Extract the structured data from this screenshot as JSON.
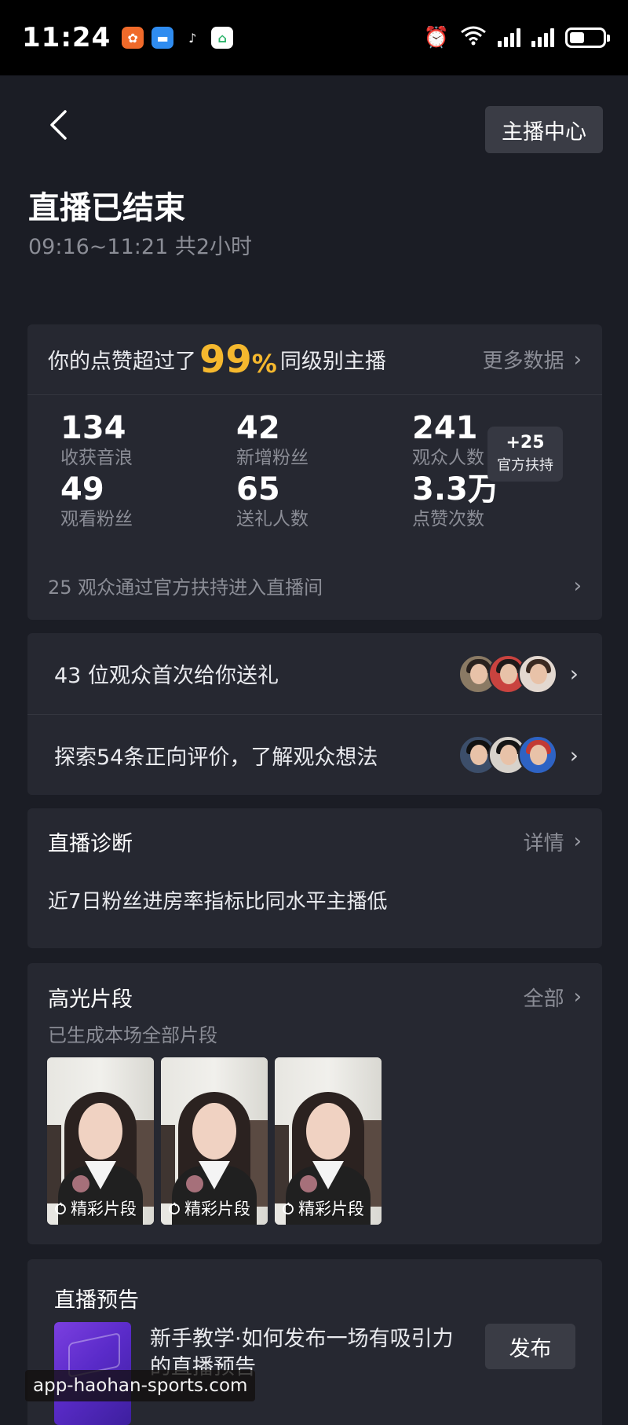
{
  "status_bar": {
    "time": "11:24",
    "apps": [
      {
        "name": "orange-app-icon",
        "color": "#f06a2a"
      },
      {
        "name": "chat-app-icon",
        "color": "#2f8cf0"
      },
      {
        "name": "tiktok-app-icon",
        "color": "#000000"
      },
      {
        "name": "home-app-icon",
        "color": "#ffffff"
      }
    ],
    "battery_level": 0.45
  },
  "header": {
    "back_label": "back",
    "anchor_center_label": "主播中心",
    "title": "直播已结束",
    "subtitle": "09:16~11:21 共2小时"
  },
  "summary": {
    "prefix": "你的点赞超过了",
    "percent": "99",
    "percent_unit": "%",
    "suffix": "同级别主播",
    "more_link": "更多数据",
    "stats": [
      {
        "value": "134",
        "label": "收获音浪"
      },
      {
        "value": "42",
        "label": "新增粉丝"
      },
      {
        "value": "241",
        "label": "观众人数"
      },
      {
        "value": "49",
        "label": "观看粉丝"
      },
      {
        "value": "65",
        "label": "送礼人数"
      },
      {
        "value": "3.3万",
        "label": "点赞次数"
      }
    ],
    "support_badge": {
      "plus": "+25",
      "label": "官方扶持"
    },
    "footer": "25 观众通过官方扶持进入直播间"
  },
  "audience": {
    "gift_row": "43 位观众首次给你送礼",
    "review_row": "探索54条正向评价，了解观众想法"
  },
  "diagnosis": {
    "title": "直播诊断",
    "link": "详情",
    "body": "近7日粉丝进房率指标比同水平主播低"
  },
  "highlights": {
    "title": "高光片段",
    "link": "全部",
    "subtitle": "已生成本场全部片段",
    "clips": [
      {
        "label": "精彩片段"
      },
      {
        "label": "精彩片段"
      },
      {
        "label": "精彩片段"
      }
    ]
  },
  "preview": {
    "title": "直播预告",
    "description": "新手教学·如何发布一场有吸引力的直播预告",
    "publish_label": "发布"
  },
  "watermark": "app-haohan-sports.com",
  "colors": {
    "background": "#1b1d25",
    "card": "#262831",
    "accent_percent": "#f5b82e",
    "muted_text": "#8b8d96"
  }
}
